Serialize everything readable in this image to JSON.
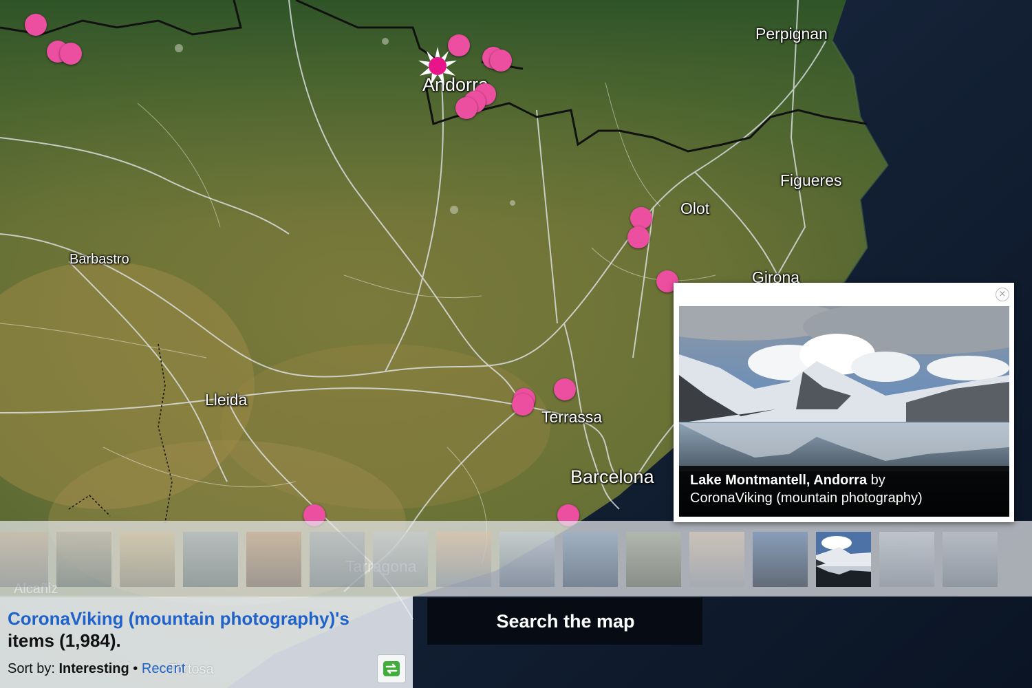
{
  "map": {
    "cities": [
      {
        "name": "Perpignan"
      },
      {
        "name": "Andorra"
      },
      {
        "name": "Figueres"
      },
      {
        "name": "Olot"
      },
      {
        "name": "Barbastro"
      },
      {
        "name": "Girona"
      },
      {
        "name": "Lleida"
      },
      {
        "name": "Terrassa"
      },
      {
        "name": "Barcelona"
      },
      {
        "name": "Tarragona"
      },
      {
        "name": "Alcañiz"
      },
      {
        "name": "Tortosa"
      }
    ],
    "marker_color": "#ec4fa0",
    "active_marker_icon": "starburst-marker-icon"
  },
  "popup": {
    "photo_title": "Lake Montmantell, Andorra",
    "by_word": "by",
    "author": "CoronaViking (mountain photography)",
    "close_icon": "×"
  },
  "filmstrip": {
    "thumb_count": 16,
    "active_index": 13
  },
  "info": {
    "owner_link": "CoronaViking (mountain photography)'s",
    "items_text": "items (1,984).",
    "sort_label": "Sort by:",
    "sort_active": "Interesting",
    "sort_separator": "•",
    "sort_other": "Recent",
    "refresh_icon": "refresh-icon"
  },
  "search_button": {
    "label": "Search the map"
  }
}
